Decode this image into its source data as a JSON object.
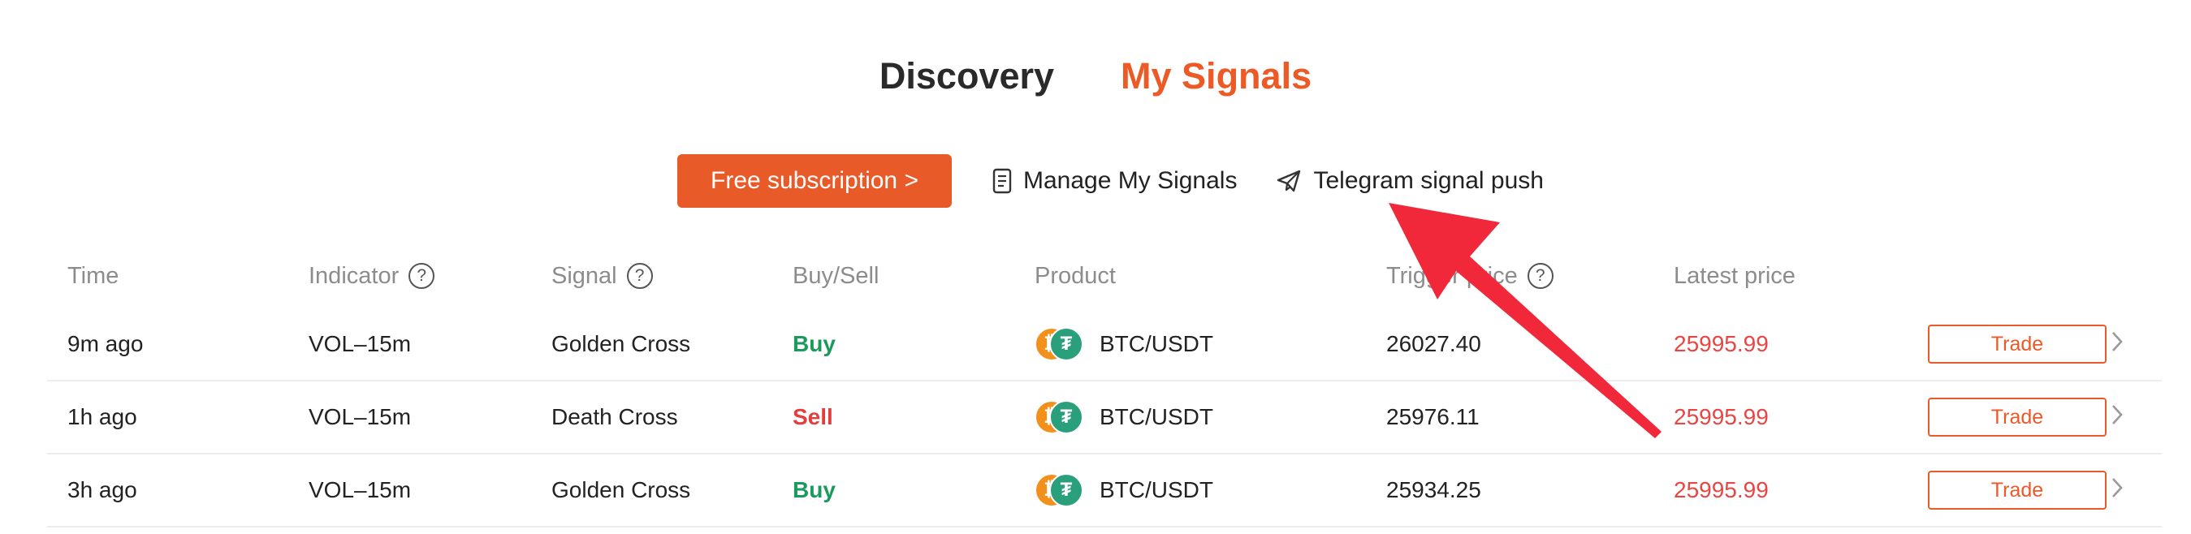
{
  "tabs": [
    {
      "label": "Discovery",
      "active": false
    },
    {
      "label": "My Signals",
      "active": true
    }
  ],
  "toolbar": {
    "subscribe_label": "Free subscription >",
    "manage_label": "Manage My Signals",
    "telegram_label": "Telegram signal push"
  },
  "table": {
    "headers": {
      "time": "Time",
      "indicator": "Indicator",
      "signal": "Signal",
      "buysell": "Buy/Sell",
      "product": "Product",
      "trigger": "Trigger price",
      "latest": "Latest price"
    },
    "help_glyph": "?",
    "rows": [
      {
        "time": "9m ago",
        "indicator": "VOL–15m",
        "signal": "Golden Cross",
        "side": "Buy",
        "product": "BTC/USDT",
        "trigger": "26027.40",
        "latest": "25995.99",
        "trade": "Trade"
      },
      {
        "time": "1h ago",
        "indicator": "VOL–15m",
        "signal": "Death Cross",
        "side": "Sell",
        "product": "BTC/USDT",
        "trigger": "25976.11",
        "latest": "25995.99",
        "trade": "Trade"
      },
      {
        "time": "3h ago",
        "indicator": "VOL–15m",
        "signal": "Golden Cross",
        "side": "Buy",
        "product": "BTC/USDT",
        "trigger": "25934.25",
        "latest": "25995.99",
        "trade": "Trade"
      }
    ]
  },
  "coins": {
    "base_glyph": "₿",
    "quote_glyph": "₮"
  },
  "colors": {
    "accent": "#e85a28",
    "buy": "#1a9a5c",
    "sell": "#e53c3c",
    "latest_price": "#e84545",
    "annotation_arrow": "#f0283a"
  },
  "icons": {
    "manage": "document-icon",
    "telegram": "paper-plane-icon",
    "help": "question-circle-icon",
    "row_action": "chevron-right-icon"
  }
}
